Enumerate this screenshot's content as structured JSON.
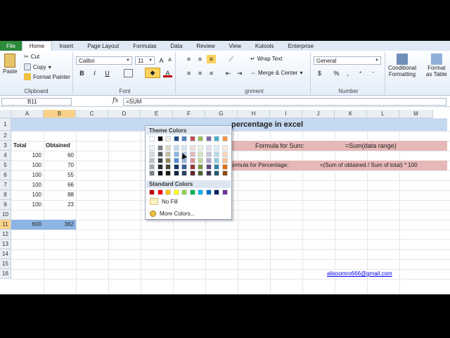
{
  "ribbon_tabs": [
    {
      "label": "File"
    },
    {
      "label": "Home"
    },
    {
      "label": "Insert"
    },
    {
      "label": "Page Layout"
    },
    {
      "label": "Formulas"
    },
    {
      "label": "Data"
    },
    {
      "label": "Review"
    },
    {
      "label": "View"
    },
    {
      "label": "Kutools"
    },
    {
      "label": "Enterprise"
    }
  ],
  "clipboard": {
    "paste": "Paste",
    "cut": "Cut",
    "copy": "Copy",
    "format_painter": "Format Painter",
    "group": "Clipboard"
  },
  "font": {
    "name": "Calibri",
    "size": "11",
    "group": "Font",
    "bold": "B",
    "italic": "I",
    "underline": "U"
  },
  "alignment": {
    "wrap": "Wrap Text",
    "merge": "Merge & Center",
    "group": "Alignment",
    "group_visible": "gnment"
  },
  "number": {
    "format": "General",
    "percent": "%",
    "comma": ",",
    "group": "Number"
  },
  "styles": {
    "conditional": "Conditional",
    "conditional2": "Formatting",
    "format_as": "Format",
    "format_as2": "as Table"
  },
  "formula_bar": {
    "name_box": "B11",
    "fx": "fx",
    "formula": "=SUM"
  },
  "columns": [
    "A",
    "B",
    "C",
    "D",
    "E",
    "F",
    "G",
    "H",
    "I",
    "J",
    "K",
    "L",
    "M"
  ],
  "rows": [
    "1",
    "2",
    "3",
    "4",
    "5",
    "6",
    "7",
    "8",
    "9",
    "10",
    "11",
    "12",
    "13",
    "14",
    "15",
    "16"
  ],
  "sheet": {
    "title_part": "percentage in excel",
    "header_total": "Total",
    "header_obtained": "Obtained",
    "totals": [
      "100",
      "100",
      "100",
      "100",
      "100",
      "100"
    ],
    "obtained": [
      "60",
      "70",
      "55",
      "66",
      "88",
      "23"
    ],
    "sum_total": "600",
    "sum_obtained": "362",
    "formula_sum_label": "Formula for Sum:",
    "formula_sum_value": "=Sum(data range)",
    "formula_pct_label": "ormula for Percentage:",
    "formula_pct_value": "=(Sum of obtained / Sum of total) * 100",
    "email": "alisoomro666@gmail.com"
  },
  "color_popup": {
    "theme_header": "Theme Colors",
    "standard_header": "Standard Colors",
    "no_fill": "No Fill",
    "more_colors": "More Colors...",
    "theme_top": [
      "#ffffff",
      "#000000",
      "#eeece1",
      "#1f497d",
      "#4f81bd",
      "#c0504d",
      "#9bbb59",
      "#8064a2",
      "#4bacc6",
      "#f79646"
    ],
    "theme_shades": [
      [
        "#f2f2f2",
        "#7f7f7f",
        "#ddd9c3",
        "#c6d9f0",
        "#dbe5f1",
        "#f2dcdb",
        "#ebf1dd",
        "#e5e0ec",
        "#dbeef3",
        "#fdeada"
      ],
      [
        "#d8d8d8",
        "#595959",
        "#c4bd97",
        "#8db3e2",
        "#b8cce4",
        "#e5b9b7",
        "#d7e3bc",
        "#ccc1d9",
        "#b7dde8",
        "#fbd5b5"
      ],
      [
        "#bfbfbf",
        "#3f3f3f",
        "#938953",
        "#548dd4",
        "#95b3d7",
        "#d99694",
        "#c3d69b",
        "#b2a2c7",
        "#92cddc",
        "#fac08f"
      ],
      [
        "#a5a5a5",
        "#262626",
        "#494429",
        "#17365d",
        "#366092",
        "#953734",
        "#76923c",
        "#5f497a",
        "#31859b",
        "#e36c09"
      ],
      [
        "#7f7f7f",
        "#0c0c0c",
        "#1d1b10",
        "#0f243e",
        "#244061",
        "#632423",
        "#4f6128",
        "#3f3151",
        "#205867",
        "#974806"
      ]
    ],
    "standard": [
      "#c00000",
      "#ff0000",
      "#ffc000",
      "#ffff00",
      "#92d050",
      "#00b050",
      "#00b0f0",
      "#0070c0",
      "#002060",
      "#7030a0"
    ]
  },
  "colors": {
    "band_blue": "#c5d9f1",
    "band_pink": "#e6b8b7",
    "selection": "#8db4e2",
    "link": "#0000ee"
  }
}
